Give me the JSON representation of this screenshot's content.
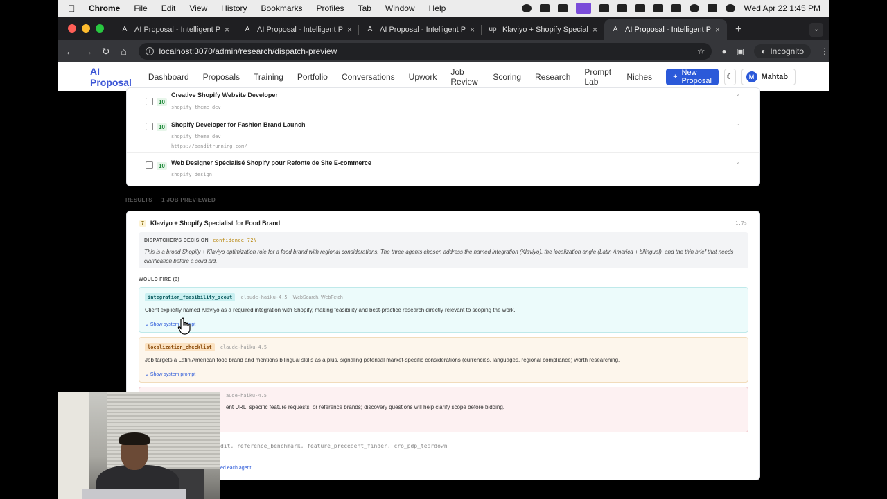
{
  "menubar": {
    "app": "Chrome",
    "items": [
      "File",
      "Edit",
      "View",
      "History",
      "Bookmarks",
      "Profiles",
      "Tab",
      "Window",
      "Help"
    ],
    "clock": "Wed Apr 22  1:45 PM"
  },
  "tabs": [
    {
      "favicon": "A",
      "title": "AI Proposal - Intelligent Propo",
      "active": false
    },
    {
      "favicon": "A",
      "title": "AI Proposal - Intelligent Propo",
      "active": false
    },
    {
      "favicon": "A",
      "title": "AI Proposal - Intelligent Propo",
      "active": false
    },
    {
      "favicon": "up",
      "title": "Klaviyo + Shopify Specialist fo",
      "active": false
    },
    {
      "favicon": "A",
      "title": "AI Proposal - Intelligent Propo",
      "active": true
    }
  ],
  "toolbar": {
    "url": "localhost:3070/admin/research/dispatch-preview",
    "incognito": "Incognito"
  },
  "header": {
    "brand": "AI Proposal",
    "nav": [
      "Dashboard",
      "Proposals",
      "Training",
      "Portfolio",
      "Conversations",
      "Upwork",
      "Job Review",
      "Scoring",
      "Research",
      "Prompt Lab",
      "Niches"
    ],
    "new_button": "New Proposal",
    "user_initial": "M",
    "user_name": "Mahtab"
  },
  "jobs": [
    {
      "score": "10",
      "title": "Creative Shopify Website Developer",
      "tags": "shopify theme dev",
      "url": ""
    },
    {
      "score": "10",
      "title": "Shopify Developer for Fashion Brand Launch",
      "tags": "shopify theme dev",
      "url": "https://banditrunning.com/"
    },
    {
      "score": "10",
      "title": "Web Designer Spécialisé Shopify pour Refonte de Site E-commerce",
      "tags": "shopify design",
      "url": ""
    }
  ],
  "results_label": "RESULTS — 1 JOB PREVIEWED",
  "result": {
    "num": "7",
    "title": "Klaviyo + Shopify Specialist for Food Brand",
    "time": "1.7s",
    "decision_label": "DISPATCHER'S DECISION",
    "confidence": "confidence 72%",
    "decision_text": "This is a broad Shopify + Klaviyo optimization role for a food brand with regional considerations. The three agents chosen address the named integration (Klaviyo), the localization angle (Latin America + bilingual), and the thin brief that needs clarification before a solid bid.",
    "would_fire": "WOULD FIRE (3)",
    "agents": [
      {
        "name": "integration_feasibility_scout",
        "model": "claude-haiku-4.5",
        "tools": "WebSearch, WebFetch",
        "reason": "Client explicitly named Klaviyo as a required integration with Shopify, making feasibility and best-practice research directly relevant to scoping the work.",
        "toggle": "Show system prompt"
      },
      {
        "name": "localization_checklist",
        "model": "claude-haiku-4.5",
        "tools": "",
        "reason": "Job targets a Latin American food brand and mentions bilingual skills as a plus, signaling potential market-specific considerations (currencies, languages, regional compliance) worth researching.",
        "toggle": "Show system prompt"
      },
      {
        "name": "",
        "model": "aude-haiku-4.5",
        "tools": "",
        "reason": "ent URL, specific feature requests, or reference brands; discovery questions will help clarify scope before bidding.",
        "toggle": ""
      }
    ],
    "not_fired": "dit, reference_benchmark, feature_precedent_finder, cro_pdp_teardown",
    "raw_link": "ed each agent"
  }
}
